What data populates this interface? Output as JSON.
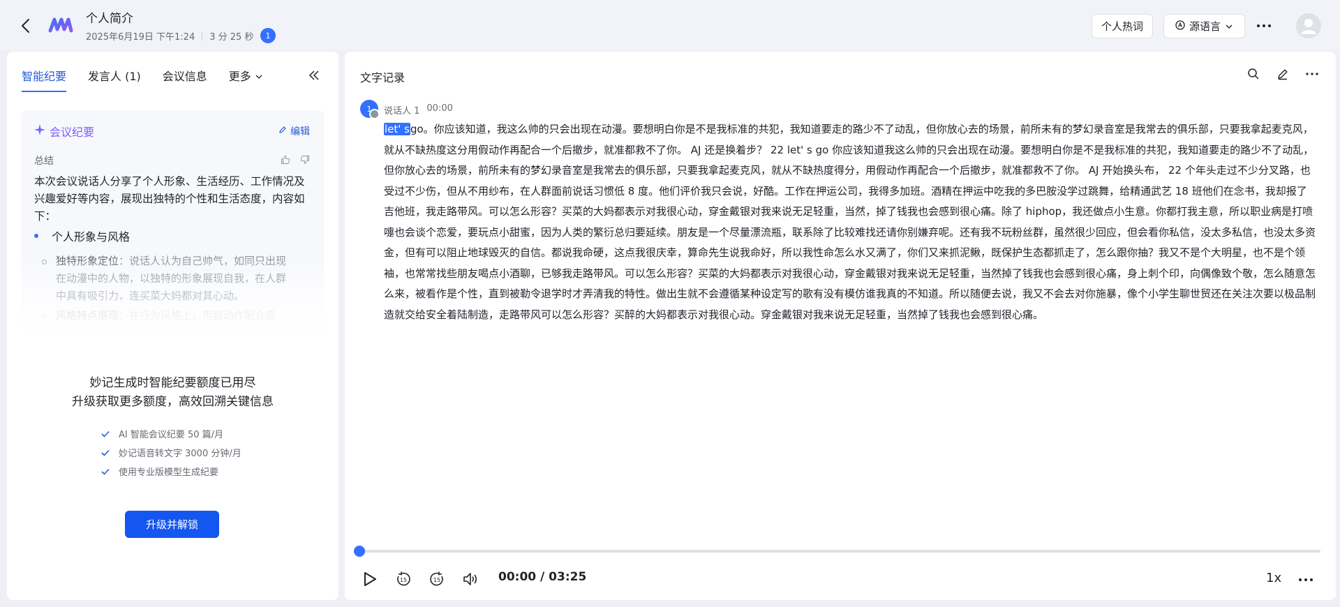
{
  "header": {
    "title": "个人简介",
    "date": "2025年6月19日 下午1:24",
    "duration": "3 分 25 秒",
    "participant_count": "1",
    "hotword_label": "个人热词",
    "language_label": "源语言"
  },
  "left_panel": {
    "tabs": [
      {
        "label": "智能纪要"
      },
      {
        "label": "发言人 (1)"
      },
      {
        "label": "会议信息"
      },
      {
        "label": "更多"
      }
    ],
    "summary": {
      "heading": "会议纪要",
      "edit_label": "编辑",
      "section_label": "总结",
      "text": "本次会议说话人分享了个人形象、生活经历、工作情况及兴趣爱好等内容，展现出独特的个性和生活态度，内容如下：",
      "bullet": "个人形象与风格",
      "sub1_title": "独特形象定位",
      "sub1_text": "：说话人认为自己帅气，如同只出现在动漫中的人物，以独特的形象展现自我，在人群中具有吸引力，连买菜大妈都对其心动。",
      "sub2_title": "风格特点展现",
      "sub2_text": "：在行为风格上，用腿动作配合后"
    },
    "quota": {
      "line1": "妙记生成时智能纪要额度已用尽",
      "line2": "升级获取更多额度，高效回溯关键信息",
      "benefits": [
        "AI 智能会议纪要 50 篇/月",
        "妙记语音转文字 3000 分钟/月",
        "使用专业版模型生成纪要"
      ],
      "upgrade_label": "升级并解锁"
    }
  },
  "right_panel": {
    "title": "文字记录",
    "speaker_avatar": "1",
    "speaker_name": "说话人 1",
    "speaker_time": "00:00",
    "highlight": "let' s",
    "transcript": "go。你应该知道，我这么帅的只会出现在动漫。要想明白你是不是我标准的共犯，我知道要走的路少不了动乱，但你放心去的场景，前所未有的梦幻录音室是我常去的俱乐部，只要我拿起麦克风，就从不缺热度这分用假动作再配合一个后撤步，就准都救不了你。 AJ 还是换着步？ 22 let' s go 你应该知道我这么帅的只会出现在动漫。要想明白你是不是我标准的共犯，我知道要走的路少不了动乱，但你放心去的场景，前所未有的梦幻录音室是我常去的俱乐部，只要我拿起麦克风，就从不缺热度得分，用假动作再配合一个后撤步，就准都救不了你。 AJ 开始换头布， 22 个年头走过不少分叉路，也受过不少伤，但从不用纱布，在人群面前说话习惯低 8 度。他们评价我只会说，好酷。工作在押运公司，我得多加班。酒精在押运中吃我的多巴胺没学过跳舞，给精通武艺 18 班他们在念书，我却报了吉他班，我走路带风。可以怎么形容？买菜的大妈都表示对我很心动，穿金戴银对我来说无足轻重，当然，掉了钱我也会感到很心痛。除了 hiphop，我还做点小生意。你都打我主意，所以职业病是打喷嚏也会谈个恋爱，要玩点小甜蜜，因为人类的繁衍总归要延续。朋友是一个尽量漂流瓶，联系除了比较难找还请你别嫌弃呢。还有我不玩粉丝群，虽然很少回应，但会看你私信，没太多私信，也没太多资金，但有可以阻止地球毁灭的自信。都说我命硬，这点我很庆幸，算命先生说我命好，所以我性命怎么水又满了，你们又来抓泥鳅，既保护生态都抓走了，怎么跟你抽？我又不是个大明星，也不是个领袖，也常常找些朋友喝点小酒聊，已够我走路带风。可以怎么形容？买菜的大妈都表示对我很心动，穿金戴银对我来说无足轻重，当然掉了钱我也会感到很心痛，身上刺个印，向偶像致个敬，怎么随意怎么来，被看作是个性，直到被勒令退学时才弄清我的特性。做出生就不会遵循某种设定写的歌有没有模仿谁我真的不知道。所以随便去说，我又不会去对你施暴，像个小学生聊世贸还在关注次要以极品制造就交给安全着陆制造，走路带风可以怎么形容？买醉的大妈都表示对我很心动。穿金戴银对我来说无足轻重，当然掉了钱我也会感到很心痛。",
    "player": {
      "time": "00:00 / 03:25",
      "speed": "1x",
      "progress": 0
    }
  }
}
